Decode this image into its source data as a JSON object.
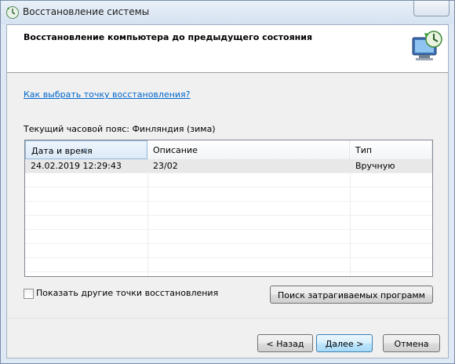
{
  "window": {
    "title": "Восстановление системы",
    "icon": "system-restore-icon"
  },
  "header": {
    "title": "Восстановление компьютера до предыдущего состояния",
    "icon": "system-restore-large-icon"
  },
  "help_link": "Как выбрать точку восстановления?",
  "timezone_label": "Текущий часовой пояс: Финляндия (зима)",
  "table": {
    "columns": [
      "Дата и время",
      "Описание",
      "Тип"
    ],
    "rows": [
      {
        "date": "24.02.2019 12:29:43",
        "description": "23/02",
        "type": "Вручную"
      }
    ]
  },
  "show_more": {
    "label": "Показать другие точки восстановления",
    "checked": false
  },
  "buttons": {
    "search": "Поиск затрагиваемых программ",
    "back": "< Назад",
    "next": "Далее >",
    "cancel": "Отмена"
  }
}
